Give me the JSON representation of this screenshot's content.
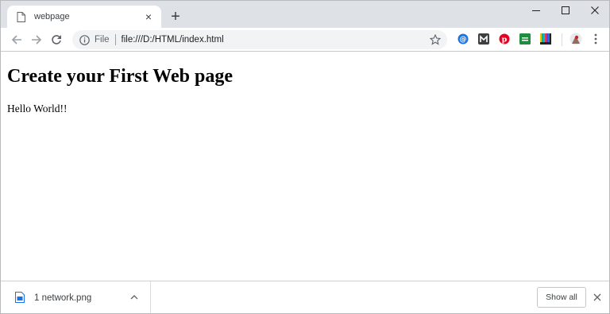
{
  "tab": {
    "title": "webpage",
    "close_glyph": "×",
    "favicon_icon": "document-icon"
  },
  "new_tab_glyph": "+",
  "window_controls": {
    "minimize_icon": "minimize-icon",
    "maximize_icon": "maximize-icon",
    "close_icon": "close-icon"
  },
  "toolbar": {
    "back_icon": "arrow-left-icon",
    "forward_icon": "arrow-right-icon",
    "reload_icon": "reload-icon",
    "omnibox": {
      "scheme_label": "File",
      "url": "file:///D:/HTML/index.html",
      "info_icon": "info-icon",
      "bookmark_icon": "star-icon"
    },
    "extensions": [
      {
        "name": "at-extension-icon",
        "color": "#1a73e8"
      },
      {
        "name": "m-extension-icon",
        "color": "#3c4043"
      },
      {
        "name": "pinterest-extension-icon",
        "color": "#e60023"
      },
      {
        "name": "green-extension-icon",
        "color": "#1e8e3e"
      },
      {
        "name": "color-bars-extension-icon",
        "color": "#fbbc04"
      }
    ],
    "profile_icon": "avatar-icon",
    "menu_icon": "kebab-menu-icon"
  },
  "page": {
    "heading": "Create your First Web page",
    "paragraph": "Hello World!!"
  },
  "download_shelf": {
    "item": {
      "filename": "1 network.png",
      "file_icon": "image-file-icon",
      "chevron_icon": "chevron-up-icon"
    },
    "show_all_label": "Show all",
    "close_icon": "close-icon"
  }
}
